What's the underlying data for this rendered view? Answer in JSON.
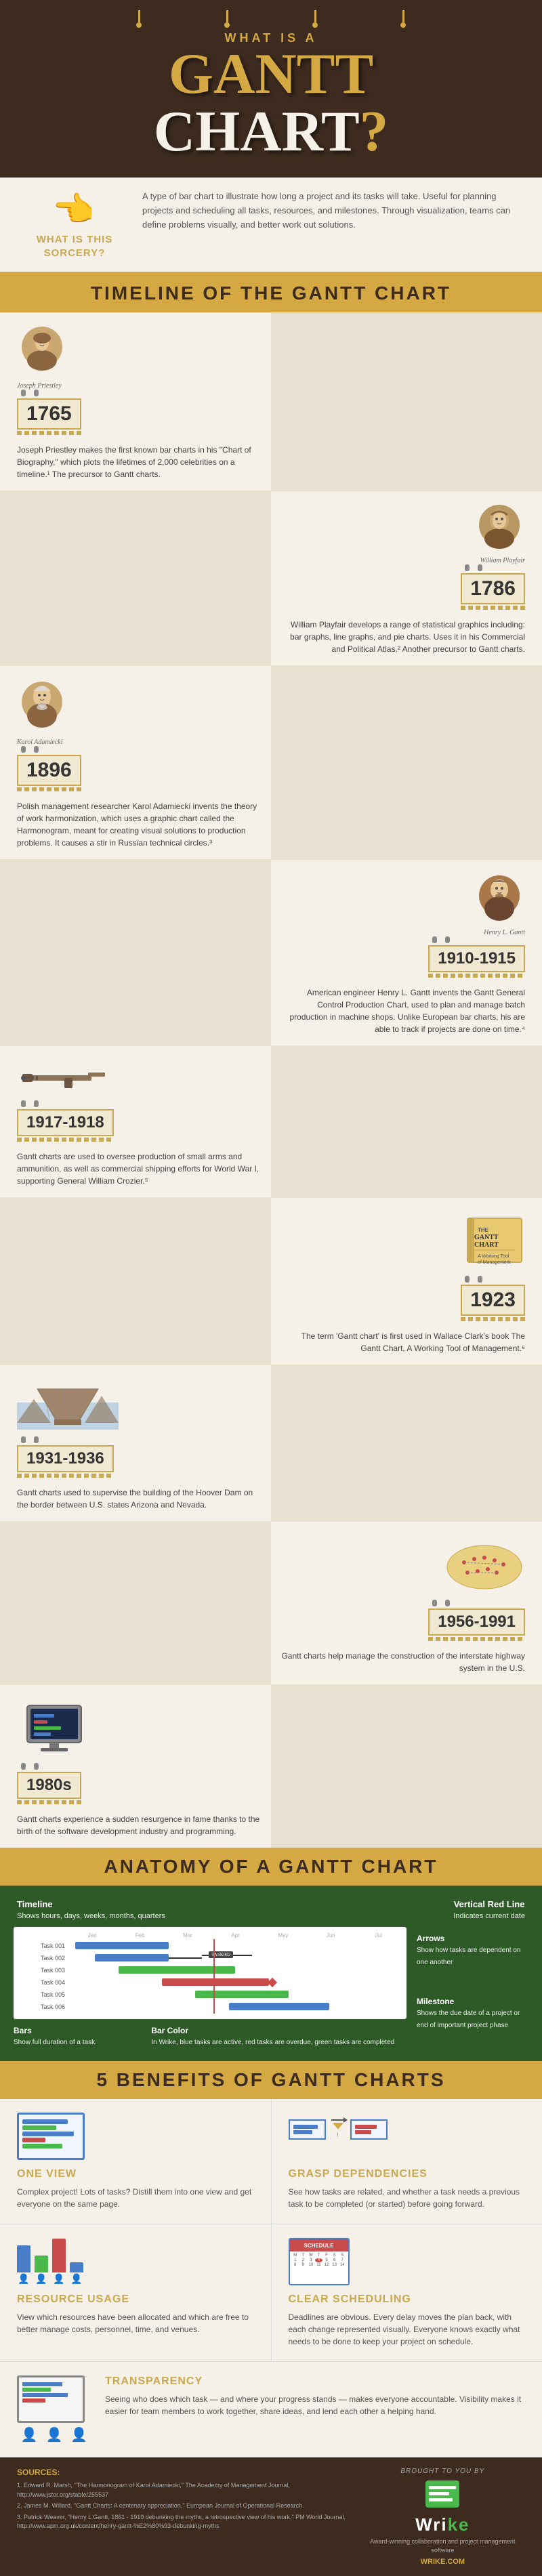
{
  "header": {
    "pre_title": "WHAT IS A",
    "title_line1": "GANTT",
    "title_line2": "CHART?",
    "chains_count": 4
  },
  "sorcery": {
    "label": "WHAT IS THIS\nSORCERY?",
    "description": "A type of bar chart to illustrate how long a project and its tasks will take. Useful for planning projects and scheduling all tasks, resources, and milestones. Through visualization, teams can define problems visually, and better work out solutions."
  },
  "timeline": {
    "section_title": "TIMELINE OF THE GANTT CHART",
    "entries": [
      {
        "id": "priestley",
        "side": "left",
        "person": "Joseph Priestley",
        "year": "1765",
        "text": "Joseph Priestley makes the first known bar charts in his \"Chart of Biography,\" which plots the lifetimes of 2,000 celebrities on a timeline.¹ The precursor to Gantt charts."
      },
      {
        "id": "playfair",
        "side": "right",
        "person": "William Playfair",
        "year": "1786",
        "text": "William Playfair develops a range of statistical graphics including: bar graphs, line graphs, and pie charts. Uses it in his Commercial and Political Atlas.² Another precursor to Gantt charts."
      },
      {
        "id": "adamiecki",
        "side": "left",
        "person": "Karol Adamiecki",
        "year": "1896",
        "text": "Polish management researcher Karol Adamiecki invents the theory of work harmonization, which uses a graphic chart called the Harmonogram, meant for creating visual solutions to production problems. It causes a stir in Russian technical circles.³"
      },
      {
        "id": "gantt",
        "side": "right",
        "person": "Henry L. Gantt",
        "year": "1910-1915",
        "text": "American engineer Henry L. Gantt invents the Gantt General Control Production Chart, used to plan and manage batch production in machine shops. Unlike European bar charts, his are able to track if projects are done on time.⁴"
      },
      {
        "id": "wwi",
        "side": "left",
        "year": "1917-1918",
        "text": "Gantt charts are used to oversee production of small arms and ammunition, as well as commercial shipping efforts for World War I, supporting General William Crozier.⁵",
        "icon": "gun"
      },
      {
        "id": "gantt_term",
        "side": "right",
        "year": "1923",
        "text": "The term 'Gantt chart' is first used in Wallace Clark's book The Gantt Chart, A Working Tool of Management.⁶",
        "icon": "book"
      },
      {
        "id": "hoover_dam",
        "side": "left",
        "year": "1931-1936",
        "text": "Gantt charts used to supervise the building of the Hoover Dam on the border between U.S. states Arizona and Nevada.",
        "icon": "dam"
      },
      {
        "id": "highway",
        "side": "right",
        "year": "1956-1991",
        "text": "Gantt charts help manage the construction of the interstate highway system in the U.S.",
        "icon": "map"
      },
      {
        "id": "software",
        "side": "left",
        "year": "1980s",
        "text": "Gantt charts experience a sudden resurgence in fame thanks to the birth of the software development industry and programming.",
        "icon": "computer"
      }
    ]
  },
  "anatomy": {
    "section_title": "ANATOMY OF A GANTT CHART",
    "labels": {
      "timeline": {
        "title": "Timeline",
        "text": "Shows hours, days, weeks, months, quarters"
      },
      "vertical_red_line": {
        "title": "Vertical Red Line",
        "text": "Indicates current date"
      },
      "arrows": {
        "title": "Arrows",
        "text": "Show how tasks are dependent on one another"
      },
      "milestone": {
        "title": "Milestone",
        "text": "Shows the due date of a project or end of important project phase"
      },
      "bars": {
        "title": "Bars",
        "text": "Show full duration of a task."
      },
      "bar_color": {
        "title": "Bar Color",
        "text": "In Wrike, blue tasks are active, red tasks are overdue, green tasks are completed"
      }
    },
    "chart_rows": [
      {
        "label": "Task 001",
        "bar": {
          "color": "blue",
          "left": "5%",
          "width": "30%"
        },
        "type": "normal"
      },
      {
        "label": "Task 002",
        "bar": {
          "color": "blue",
          "left": "10%",
          "width": "25%"
        },
        "type": "normal"
      },
      {
        "label": "Task 003",
        "bar": {
          "color": "green",
          "left": "20%",
          "width": "35%"
        },
        "type": "normal"
      },
      {
        "label": "Task 004",
        "bar": {
          "color": "red",
          "left": "30%",
          "width": "30%"
        },
        "type": "normal"
      },
      {
        "label": "Task 005",
        "bar": {
          "color": "green",
          "left": "40%",
          "width": "25%"
        },
        "type": "normal"
      },
      {
        "label": "Task 006",
        "bar": {
          "color": "blue",
          "left": "50%",
          "width": "30%"
        },
        "type": "normal"
      }
    ]
  },
  "benefits": {
    "section_title": "5 BENEFITS OF GANTT CHARTS",
    "items": [
      {
        "id": "one_view",
        "title": "ONE VIEW",
        "text": "Complex project! Lots of tasks? Distill them into one view and get everyone on the same page.",
        "icon": "screen"
      },
      {
        "id": "grasp_dependencies",
        "title": "GRASP DEPENDENCIES",
        "text": "See how tasks are related, and whether a task needs a previous task to be completed (or started) before going forward.",
        "icon": "deps"
      },
      {
        "id": "resource_usage",
        "title": "RESOURCE USAGE",
        "text": "View which resources have been allocated and which are free to better manage costs, personnel, time, and venues.",
        "icon": "resource"
      },
      {
        "id": "clear_scheduling",
        "title": "CLEAR SCHEDULING",
        "text": "Deadlines are obvious. Every delay moves the plan back, with each change represented visually. Everyone knows exactly what needs to be done to keep your project on schedule.",
        "icon": "calendar"
      },
      {
        "id": "transparency",
        "title": "TRANSPARENCY",
        "text": "Seeing who does which task — and where your progress stands — makes everyone accountable. Visibility makes it easier for team members to work together, share ideas, and lend each other a helping hand.",
        "icon": "transparency"
      }
    ]
  },
  "footer": {
    "sources_title": "SOURCES:",
    "sources": [
      "1. Edward R. Marsh, \"The Harmonogram of Karol Adamiecki,\" The Academy of Management Journal, http://www.jstor.org/stable/255537",
      "2. James M. Willard, \"Gantt Charts: A centenary appreciation,\" European Journal of Operational Research.",
      "3. Patrick Weaver, \"Henry L Gantt, 1861 - 1919 debunking the myths, a retrospective view of his work,\" PM World Journal, http://www.apm.org.uk/content/henry-gantt-%E2%80%93-debunking-myths"
    ],
    "brought_by": "BROUGHT TO YOU BY",
    "wrike_logo": "Wrike",
    "wrike_tagline": "Award-winning collaboration and\nproject management software",
    "wrike_url": "WRIKE.COM"
  },
  "colors": {
    "gold": "#d4a843",
    "dark_brown": "#3d2b1f",
    "green": "#2d5a27",
    "red": "#c84a4a",
    "blue": "#4a7dc8",
    "light_bg": "#f5f0e8"
  }
}
